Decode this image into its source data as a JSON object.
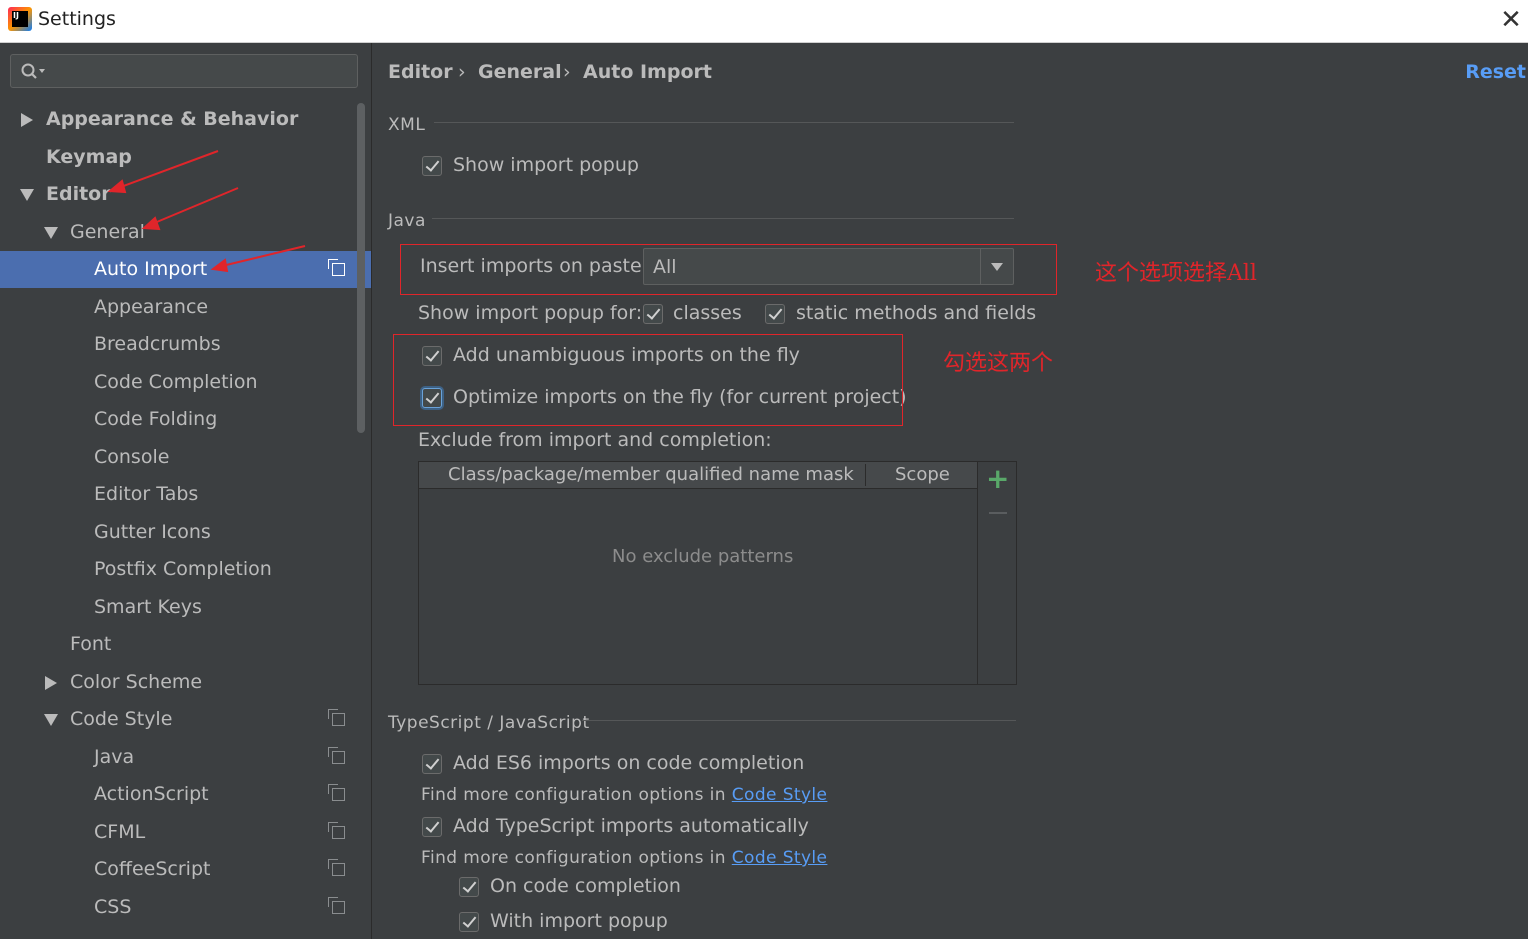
{
  "window": {
    "title": "Settings",
    "app_icon_text": "IJ"
  },
  "search": {
    "placeholder": ""
  },
  "tree": {
    "items": [
      {
        "label": "Appearance & Behavior"
      },
      {
        "label": "Keymap"
      },
      {
        "label": "Editor"
      },
      {
        "label": "General"
      },
      {
        "label": "Auto Import"
      },
      {
        "label": "Appearance"
      },
      {
        "label": "Breadcrumbs"
      },
      {
        "label": "Code Completion"
      },
      {
        "label": "Code Folding"
      },
      {
        "label": "Console"
      },
      {
        "label": "Editor Tabs"
      },
      {
        "label": "Gutter Icons"
      },
      {
        "label": "Postfix Completion"
      },
      {
        "label": "Smart Keys"
      },
      {
        "label": "Font"
      },
      {
        "label": "Color Scheme"
      },
      {
        "label": "Code Style"
      },
      {
        "label": "Java"
      },
      {
        "label": "ActionScript"
      },
      {
        "label": "CFML"
      },
      {
        "label": "CoffeeScript"
      },
      {
        "label": "CSS"
      }
    ]
  },
  "breadcrumb": {
    "items": [
      "Editor",
      "General",
      "Auto Import"
    ],
    "separator": "›"
  },
  "reset_label": "Reset",
  "xml": {
    "section": "XML",
    "show_import_popup": "Show import popup"
  },
  "java": {
    "section": "Java",
    "insert_imports_label": "Insert imports on paste:",
    "insert_imports_value": "All",
    "show_popup_for_label": "Show import popup for:",
    "classes_label": "classes",
    "static_label": "static methods and fields",
    "add_unambiguous": "Add unambiguous imports on the fly",
    "optimize_imports": "Optimize imports on the fly (for current project)",
    "exclude_label": "Exclude from import and completion:",
    "table_col1": "Class/package/member qualified name mask",
    "table_col2": "Scope",
    "table_empty": "No exclude patterns"
  },
  "ts": {
    "section": "TypeScript / JavaScript",
    "add_es6": "Add ES6 imports on code completion",
    "find_more_1": "Find more configuration options in",
    "link_1": "Code Style",
    "add_ts": "Add TypeScript imports automatically",
    "find_more_2": "Find more configuration options in",
    "link_2": "Code Style",
    "on_completion": "On code completion",
    "with_popup": "With import popup"
  },
  "annotations": {
    "select_all": "这个选项选择All",
    "check_two": "勾选这两个"
  },
  "colors": {
    "background": "#3c3f41",
    "selection": "#4b6eaf",
    "link": "#589df6",
    "annotation": "#e0252a",
    "add_button": "#59a869"
  }
}
